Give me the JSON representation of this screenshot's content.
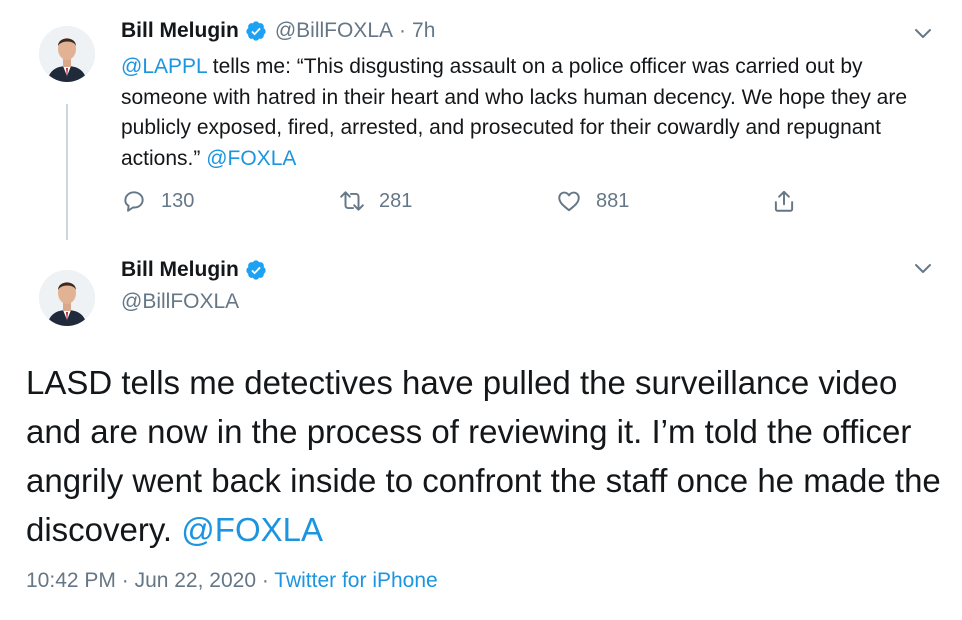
{
  "colors": {
    "link": "#1b95e0",
    "muted": "#657786",
    "text": "#14171a",
    "verified": "#1da1f2"
  },
  "tweet1": {
    "author_name": "Bill Melugin",
    "author_handle": "@BillFOXLA",
    "separator": "·",
    "time": "7h",
    "text": {
      "mention": "@LAPPL",
      "body": " tells me: “This disgusting assault on a police officer was carried out by someone with hatred in their heart and who lacks human decency. We hope they are publicly exposed, fired, arrested, and prosecuted for their cowardly and repugnant actions.” ",
      "tag": "@FOXLA"
    },
    "actions": {
      "reply_count": "130",
      "retweet_count": "281",
      "like_count": "881"
    },
    "icons": [
      "chevron-down-icon",
      "reply-icon",
      "retweet-icon",
      "like-icon",
      "share-icon",
      "verified-icon"
    ]
  },
  "tweet2": {
    "author_name": "Bill Melugin",
    "author_handle": "@BillFOXLA",
    "text": {
      "body": "LASD tells me detectives have pulled the surveillance video and are now in the process of reviewing it. I’m told the officer angrily went back inside to confront the staff once he made the discovery. ",
      "tag": "@FOXLA"
    },
    "meta": {
      "time": "10:42 PM",
      "separator1": " · ",
      "date": "Jun 22, 2020",
      "separator2": " · ",
      "source": "Twitter for iPhone"
    }
  }
}
